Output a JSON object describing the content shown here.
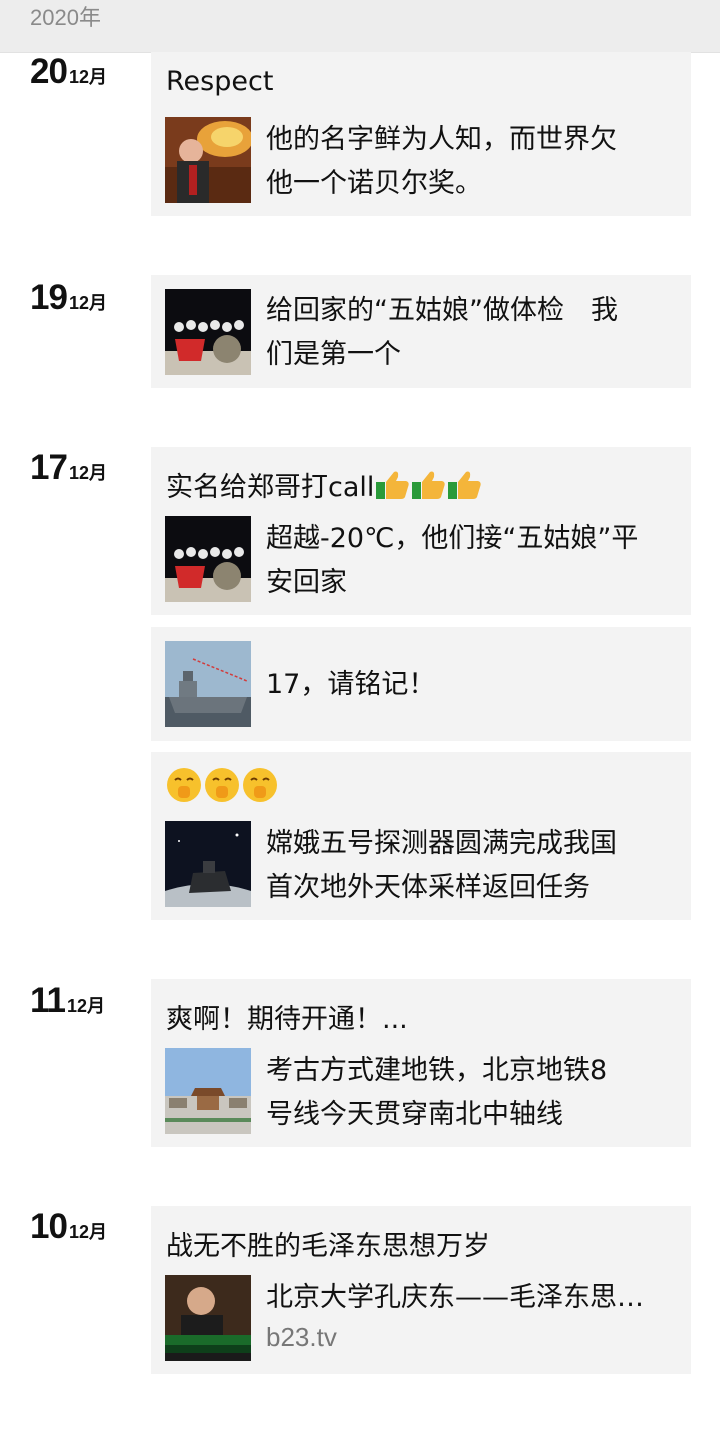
{
  "header": {
    "year": "2020年"
  },
  "entries": [
    {
      "day": "20",
      "month": "12月"
    },
    {
      "day": "19",
      "month": "12月"
    },
    {
      "day": "17",
      "month": "12月"
    },
    {
      "day": "11",
      "month": "12月"
    },
    {
      "day": "10",
      "month": "12月"
    }
  ],
  "posts": [
    {
      "caption": "Respect",
      "link_line1": "他的名字鲜为人知，而世界欠",
      "link_line2": "他一个诺贝尔奖。"
    },
    {
      "link_line1": "给回家的“五姑娘”做体检　我",
      "link_line2": "们是第一个"
    },
    {
      "caption": "实名给郑哥打call",
      "caption_emoji": "thumbs-up-icon x3",
      "link_line1": "超越-20℃，他们接“五姑娘”平",
      "link_line2": "安回家"
    },
    {
      "link_line1": "17，请铭记！"
    },
    {
      "caption_emoji": "shush-face-icon x3",
      "link_line1": "嫦娥五号探测器圆满完成我国",
      "link_line2": "首次地外天体采样返回任务"
    },
    {
      "caption": "爽啊！期待开通！...",
      "link_line1": "考古方式建地铁，北京地铁8",
      "link_line2": "号线今天贯穿南北中轴线"
    },
    {
      "caption": "战无不胜的毛泽东思想万岁",
      "link_line1": "北京大学孔庆东——毛泽东思…",
      "link_source": "b23.tv"
    }
  ]
}
